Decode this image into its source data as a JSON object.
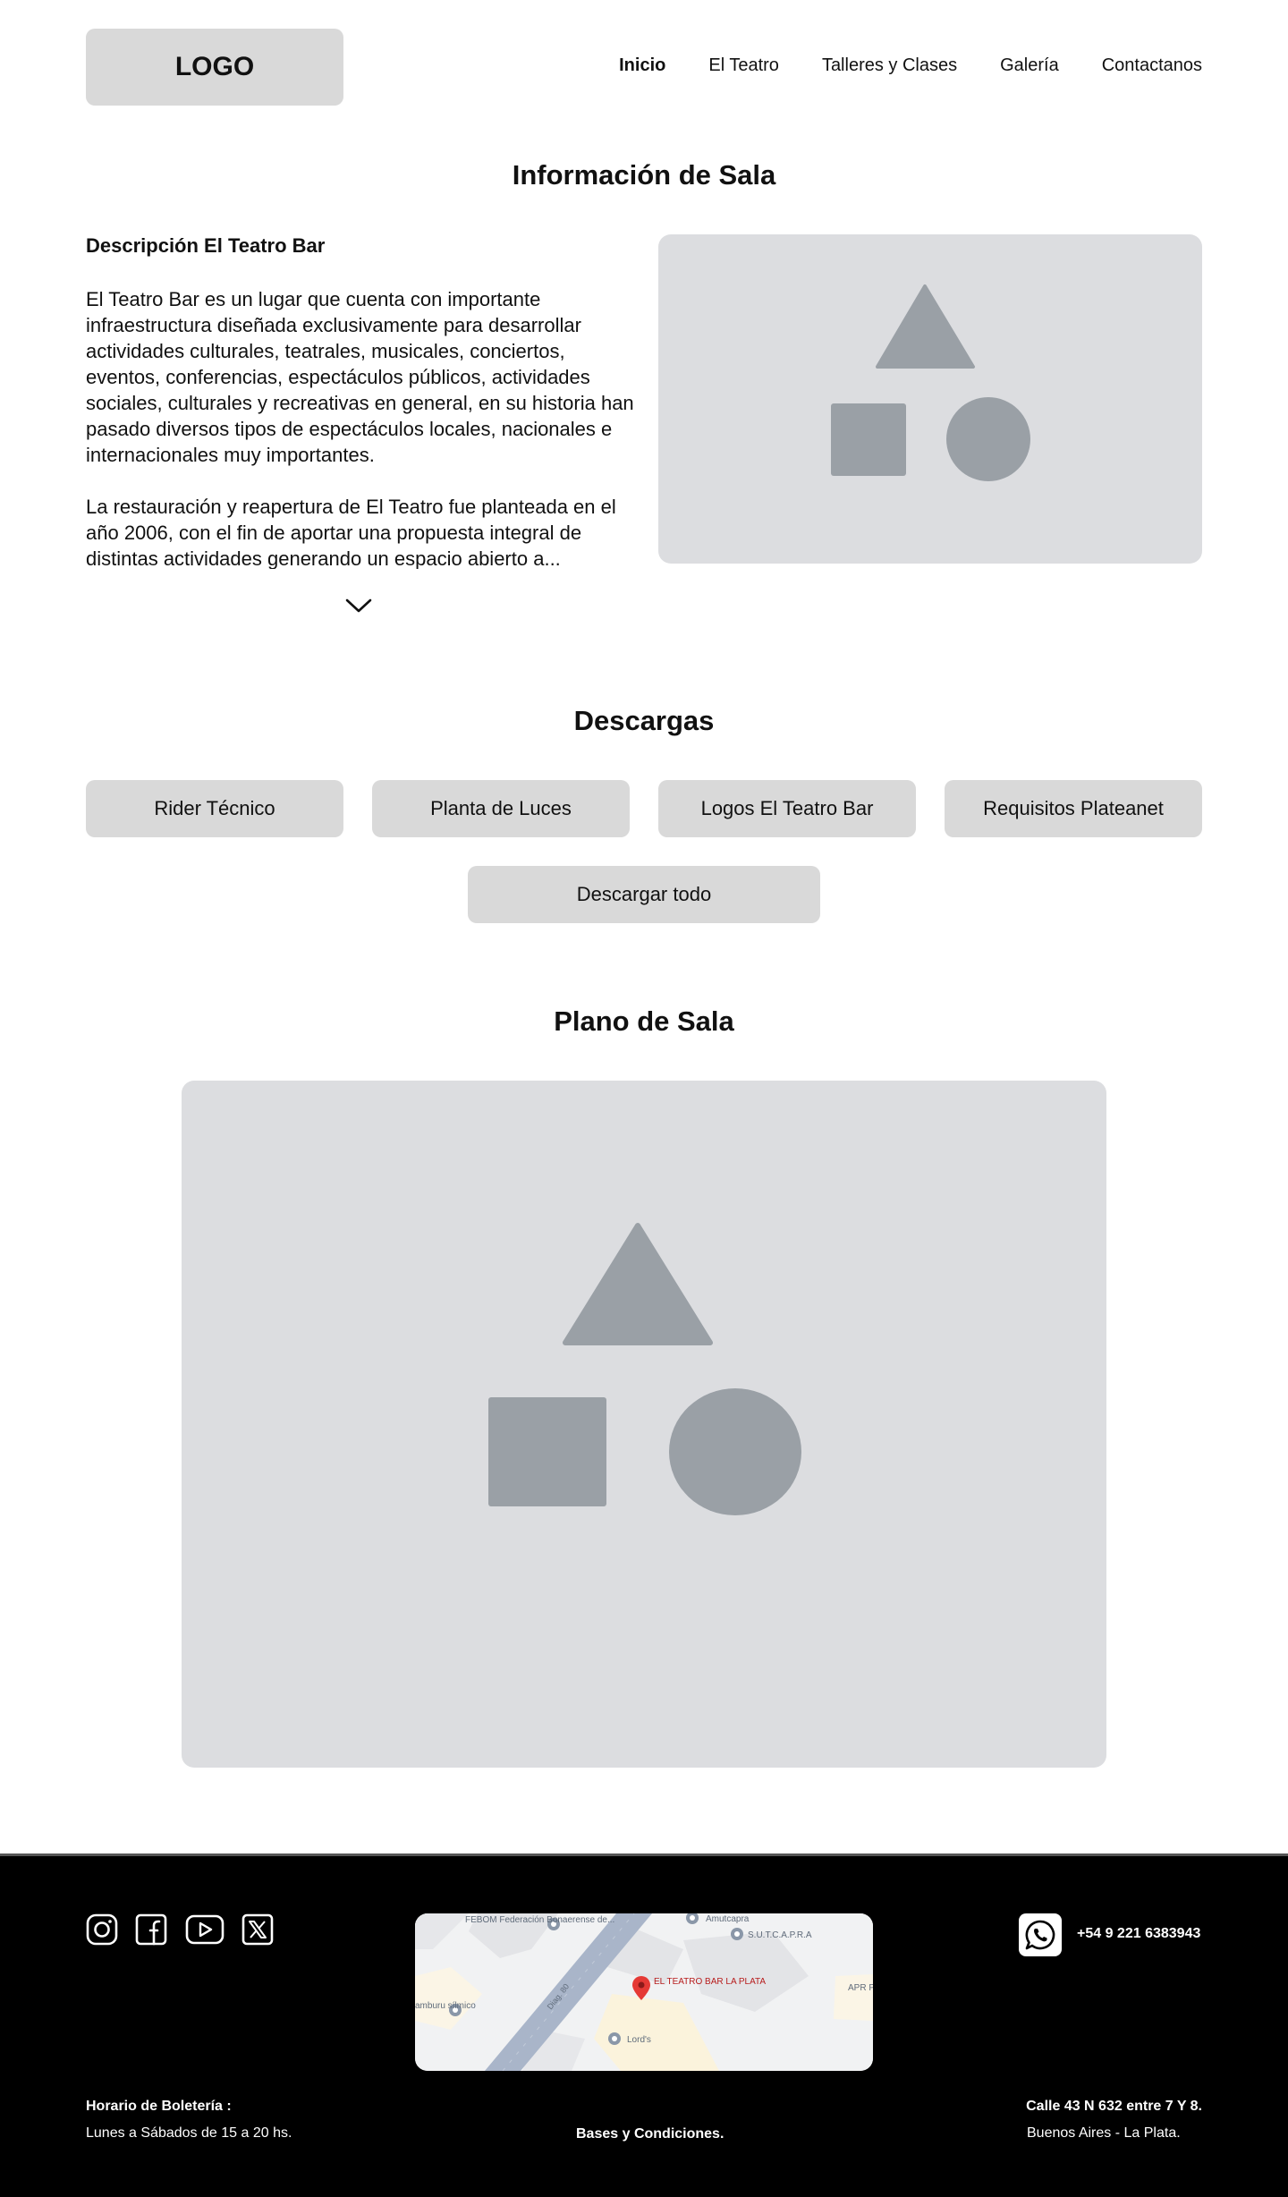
{
  "header": {
    "logo": "LOGO",
    "nav": [
      "Inicio",
      "El Teatro",
      "Talleres y Clases",
      "Galería",
      "Contactanos"
    ]
  },
  "info": {
    "title": "Información de Sala",
    "desc_heading": "Descripción El Teatro Bar",
    "paragraph_1": "El Teatro Bar es un lugar que cuenta con importante infraestructura diseñada exclusivamente para desarrollar actividades culturales, teatrales, musicales, conciertos, eventos, conferencias, espectáculos públicos, actividades sociales, culturales y recreativas en general, en su historia han pasado diversos tipos de espectáculos locales, nacionales e internacionales muy importantes.",
    "paragraph_2": "La restauración y reapertura de El Teatro fue planteada en el año 2006, con el fin de aportar una propuesta integral de distintas actividades generando un espacio abierto a...",
    "expand_icon": "chevron-down-icon",
    "image_icon": "image-placeholder-icon"
  },
  "downloads": {
    "title": "Descargas",
    "buttons": [
      "Rider Técnico",
      "Planta de Luces",
      "Logos El Teatro Bar",
      "Requisitos Plateanet"
    ],
    "all_label": "Descargar todo"
  },
  "plan": {
    "title": "Plano de Sala",
    "image_icon": "image-placeholder-icon"
  },
  "footer": {
    "social_icons": [
      "instagram-icon",
      "facebook-icon",
      "youtube-icon",
      "x-icon"
    ],
    "map": {
      "labels": [
        "FEBOM Federación Bonaerense de...",
        "Amutcapra",
        "S.U.T.C.A.P.R.A",
        "EL TEATRO BAR LA PLATA",
        "Lord's",
        "APR Pro N",
        "amburu sílmico",
        "Diag. 80"
      ],
      "pin_color": "#e53935"
    },
    "whatsapp_icon": "whatsapp-icon",
    "phone": "+54 9 221 6383943",
    "hours_label": "Horario de Boletería :",
    "hours_value": "Lunes a Sábados de 15 a 20 hs.",
    "terms": "Bases y Condiciones.",
    "address_line1": "Calle 43 N 632 entre 7 Y 8.",
    "address_line2": "Buenos Aires - La Plata."
  },
  "colors": {
    "placeholder_bg": "#dcdde0",
    "placeholder_shape": "#9aa0a6",
    "button_bg": "#d9d9d9",
    "footer_bg": "#000000"
  }
}
